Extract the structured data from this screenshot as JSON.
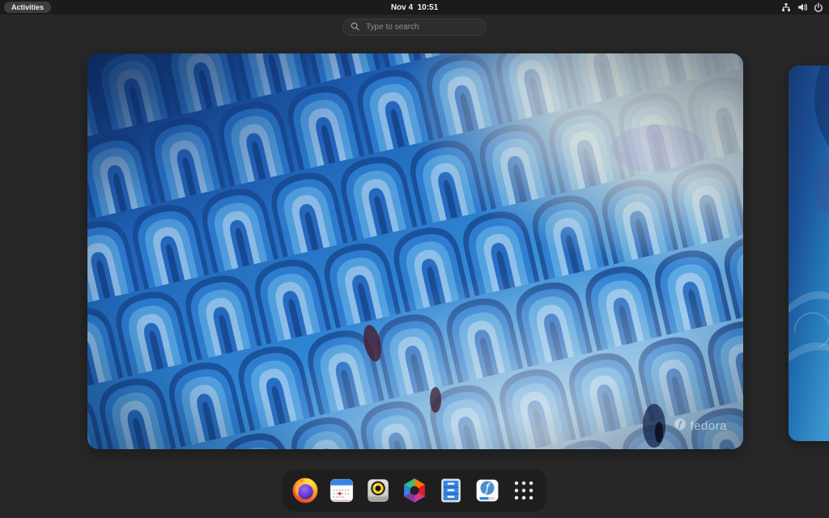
{
  "top_bar": {
    "activities_label": "Activities",
    "clock": "Nov 4  10:51",
    "tray_icons": [
      "network-icon",
      "volume-icon",
      "power-icon"
    ]
  },
  "search": {
    "placeholder": "Type to search",
    "icon": "search-icon"
  },
  "workspaces": {
    "visible_count": 2,
    "active_watermark": "fedora"
  },
  "dock": {
    "apps": [
      "firefox",
      "calendar",
      "music-player",
      "photos",
      "files",
      "fedora-media-writer"
    ],
    "show_apps": "show-apps-grid"
  },
  "colors": {
    "topbar_bg": "#1b1b1b",
    "overview_bg": "#272727",
    "dock_bg": "#1e1e1e",
    "accent_blue": "#3584e4",
    "calendar_red": "#ed333b",
    "lens_ring_yellow": "#f6d32d",
    "search_placeholder": "#8f8f8f"
  }
}
